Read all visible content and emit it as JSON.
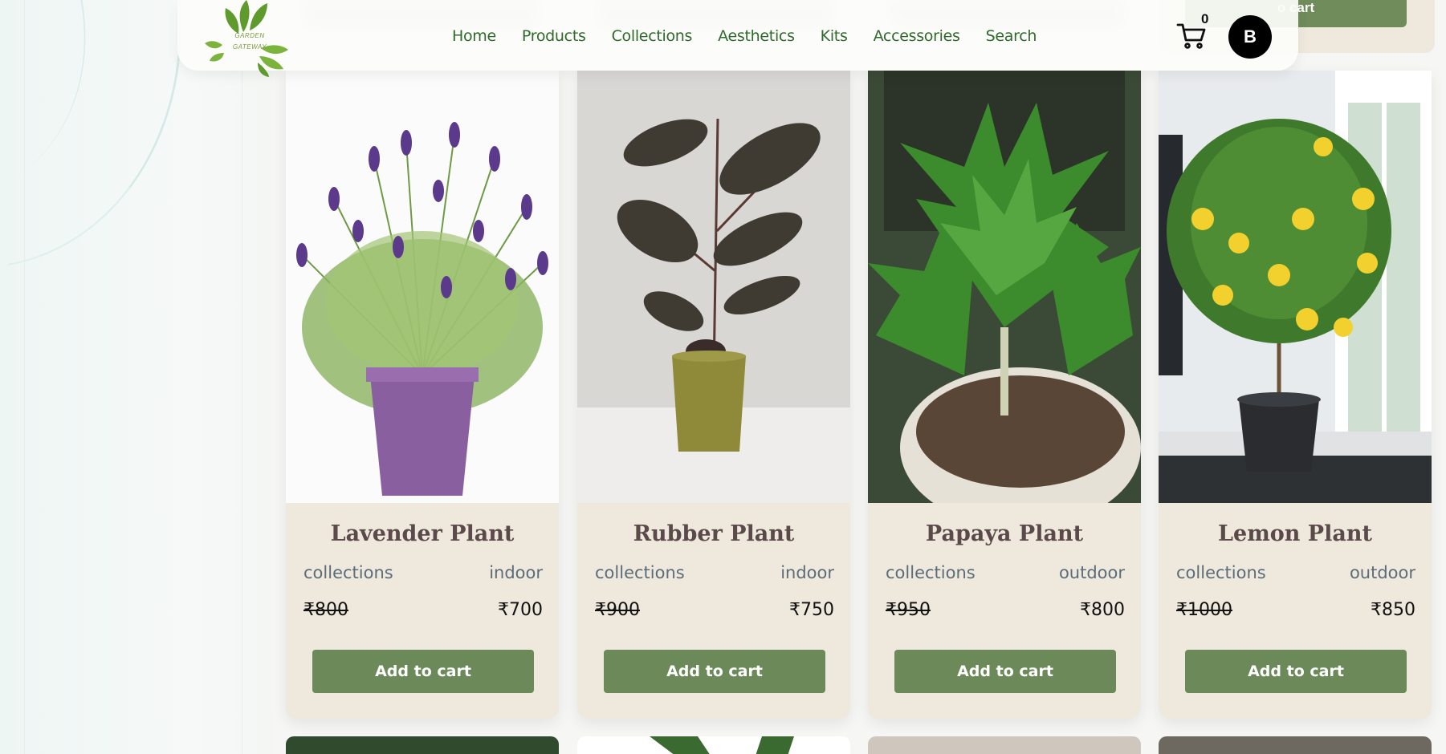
{
  "brand": {
    "logo_line1": "GARDEN",
    "logo_line2": "GATEWAY"
  },
  "nav": {
    "links": [
      "Home",
      "Products",
      "Collections",
      "Aesthetics",
      "Kits",
      "Accessories",
      "Search"
    ],
    "cart_count": "0",
    "avatar_initial": "B"
  },
  "previous_row": {
    "button_fragment": "o cart"
  },
  "products": [
    {
      "title": "Lavender Plant",
      "category": "collections",
      "type": "indoor",
      "old_price": "₹800",
      "price": "₹700",
      "button": "Add to cart"
    },
    {
      "title": "Rubber Plant",
      "category": "collections",
      "type": "indoor",
      "old_price": "₹900",
      "price": "₹750",
      "button": "Add to cart"
    },
    {
      "title": "Papaya Plant",
      "category": "collections",
      "type": "outdoor",
      "old_price": "₹950",
      "price": "₹800",
      "button": "Add to cart"
    },
    {
      "title": "Lemon Plant",
      "category": "collections",
      "type": "outdoor",
      "old_price": "₹1000",
      "price": "₹850",
      "button": "Add to cart"
    }
  ],
  "colors": {
    "accent_green": "#6c8a59",
    "nav_text": "#2f6a2c",
    "card_bg": "#efe8dc"
  }
}
